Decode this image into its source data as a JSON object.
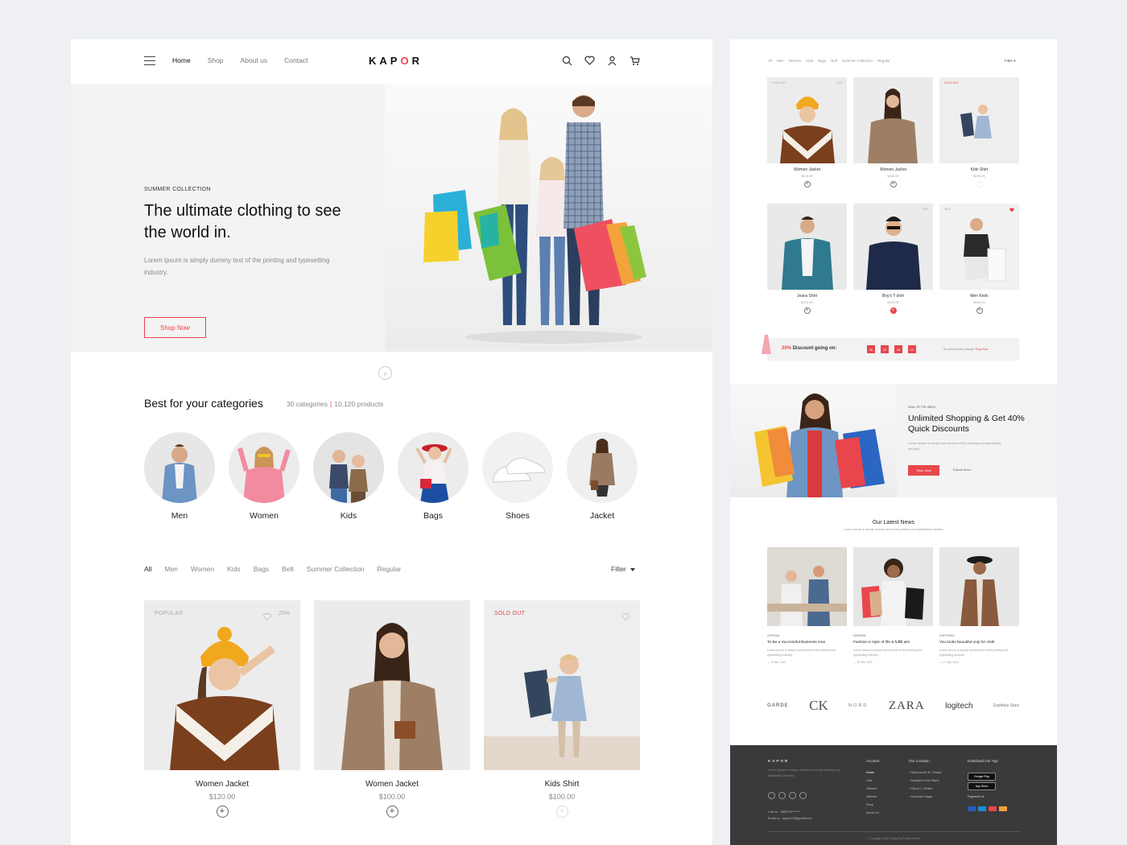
{
  "nav": {
    "links": [
      "Home",
      "Shop",
      "About us",
      "Contact"
    ],
    "logo": "KAPOR"
  },
  "hero": {
    "kicker": "SUMMER COLLECTION",
    "title": "The ultimate clothing to see the world in.",
    "text": "Lorem Ipsum is simply dummy text of the printing and typesetting industry.",
    "button": "Shop Now",
    "arrow": "›"
  },
  "categories": {
    "title": "Best for your categories",
    "count": "30 categories",
    "sep": "|",
    "products": "10,120 products",
    "items": [
      "Men",
      "Women",
      "Kids",
      "Bags",
      "Shoes",
      "Jacket"
    ]
  },
  "filters": {
    "tabs": [
      "All",
      "Men",
      "Women",
      "Kids",
      "Bags",
      "Belt",
      "Summer Collection",
      "Regular"
    ],
    "filter": "Filter"
  },
  "products": [
    {
      "badge": "POPULAR",
      "discount": "20%",
      "name": "Women Jacket",
      "price": "$120.00"
    },
    {
      "badge": "",
      "discount": "",
      "name": "Women Jacket",
      "price": "$100.00"
    },
    {
      "badge": "SOLD OUT",
      "discount": "",
      "name": "Kids Shirt",
      "price": "$100.00"
    }
  ],
  "right": {
    "tabs": [
      "All",
      "Men",
      "Women",
      "Kids",
      "Bags",
      "Belt",
      "Summer Collection",
      "Regular"
    ],
    "filter": "Filter",
    "products": [
      {
        "badge": "POPULAR",
        "discount": "20%",
        "name": "Women Jacket",
        "price": "$120.00"
      },
      {
        "badge": "",
        "discount": "",
        "name": "Women Jacket",
        "price": "$100.00"
      },
      {
        "badge": "SOLD OUT",
        "discount": "",
        "name": "Kids Shirt",
        "price": "$100.00"
      },
      {
        "badge": "",
        "discount": "",
        "name": "Jeans Shirt",
        "price": "$120.00"
      },
      {
        "badge": "",
        "discount": "20%",
        "name": "Boy's T-shirt",
        "price": "$100.00"
      },
      {
        "badge": "NEW",
        "discount": "",
        "name": "Men Keds",
        "price": "$100.00"
      }
    ],
    "discount_bar": {
      "percent": "20%",
      "text": "Discount going on:",
      "timer": [
        "30",
        "23",
        "15",
        "12"
      ],
      "note": "Do not miss this change!",
      "link": "Shop Now"
    },
    "deal": {
      "kicker": "DEAL OF THE WEEK",
      "title": "Unlimited Shopping & Get 40% Quick Discounts",
      "text": "Lorem Ipsum is simply dummy text of the printing and typesetting industry.",
      "button": "Shop Now",
      "explore": "Explore Soon !"
    },
    "news": {
      "title": "Our Latest News",
      "subtitle": "Lorem Ipsum is simply dummy text of the printing and typesetting industry.",
      "items": [
        {
          "tag": "OFFICIAL",
          "title": "To Be a Successful Business man",
          "text": "Lorem Ipsum is simply dummy text of the printing and typesetting industry.",
          "date": "— 20 Mar, 2021"
        },
        {
          "tag": "FASHION",
          "title": "Fashion is style of life & fulfill aim",
          "text": "Lorem Ipsum is simply dummy text of the printing and typesetting industry.",
          "date": "— 15 Feb, 2022"
        },
        {
          "tag": "CHOTHING",
          "title": "You looks beautiful only for cloth",
          "text": "Lorem Ipsum is simply dummy text of the printing and typesetting industry.",
          "date": "— 17 Sep, 2022"
        }
      ]
    },
    "brands": [
      "GARDE",
      "CK",
      "NORD",
      "ZARA",
      "logitech",
      "Expletus Sans"
    ],
    "footer": {
      "logo": "KAPOR",
      "about": "Lorem Ipsum is simply dummy text of the printing and typesetting industry.",
      "call": "Call us : +880175*******",
      "email": "Email us : kapor123@gmail.com",
      "account_title": "Account",
      "account": [
        "Home",
        "Cart",
        "Wishlist",
        "Wishlist",
        "Shop",
        "About Us"
      ],
      "location_title": "Our Location",
      "locations": [
        "Dhanmondi 32, Dhaka",
        "Bangabur Rail Stand",
        "Mirpur 1, Dhaka",
        "Alomnam Nagar"
      ],
      "app_title": "Download Our App",
      "google": "Google Play",
      "apple": "App Store",
      "payment_title": "Payment Us",
      "copyright": "© Copyright 2022, Design By Foysal Ahmed"
    }
  }
}
